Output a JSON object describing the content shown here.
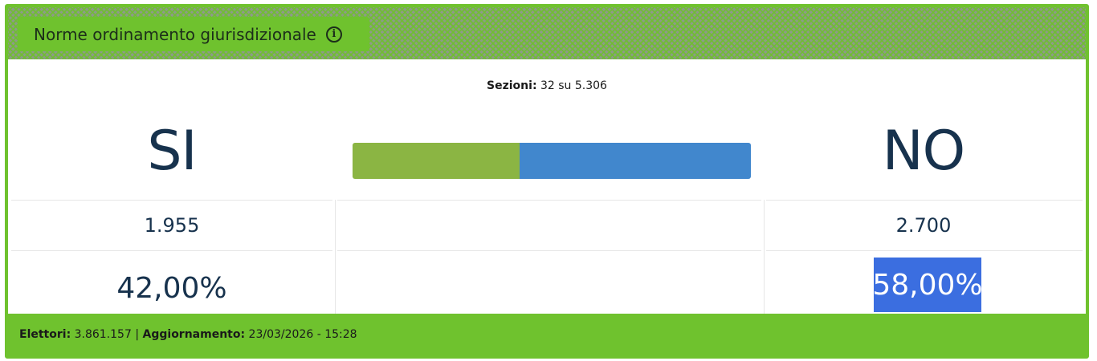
{
  "header": {
    "title": "Norme ordinamento giurisdizionale",
    "info_icon": "info-icon"
  },
  "sezioni": {
    "label": "Sezioni:",
    "value": "32 su 5.306"
  },
  "si": {
    "label": "SI",
    "votes": "1.955",
    "percent": "42,00%",
    "color": "#8bb543"
  },
  "no": {
    "label": "NO",
    "votes": "2.700",
    "percent": "58,00%",
    "color": "#4187cd",
    "highlight_color": "#3b6ee0"
  },
  "bar": {
    "si_share": 0.42,
    "no_share": 0.58
  },
  "footer": {
    "elettori_label": "Elettori:",
    "elettori_value": "3.861.157",
    "separator": "|",
    "aggiornamento_label": "Aggiornamento:",
    "aggiornamento_value": "23/03/2026 - 15:28"
  },
  "colors": {
    "accent_green": "#6fc22e",
    "text_dark": "#17324d"
  }
}
